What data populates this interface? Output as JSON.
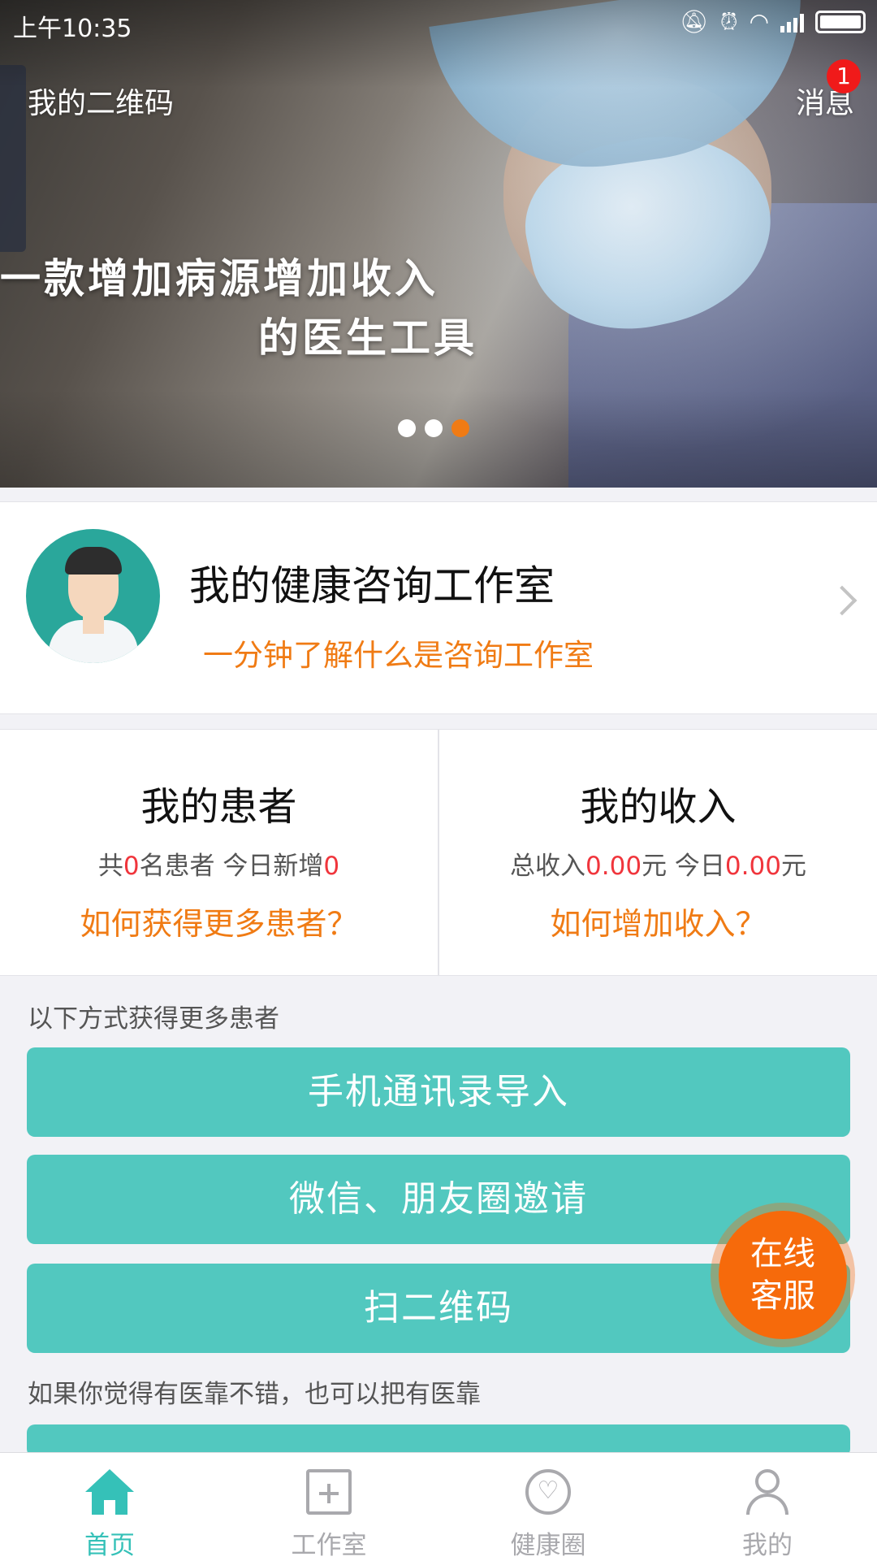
{
  "status_bar": {
    "time": "上午10:35",
    "icons": [
      "mute-icon",
      "alarm-icon",
      "wifi-icon",
      "signal-icon",
      "battery-icon"
    ]
  },
  "banner": {
    "qr_label": "我的二维码",
    "message_label": "消息",
    "message_badge": "1",
    "headline_1": "一款增加病源增加收入",
    "headline_2": "的医生工具",
    "slides_total": 3,
    "slide_active": 3
  },
  "studio": {
    "title": "我的健康咨询工作室",
    "subtitle": "一分钟了解什么是咨询工作室"
  },
  "stats": {
    "patients": {
      "title": "我的患者",
      "prefix": "共",
      "total": "0",
      "mid": "名患者 今日新增",
      "today": "0",
      "link": "如何获得更多患者？"
    },
    "income": {
      "title": "我的收入",
      "prefix": "总收入",
      "total": "0.00",
      "mid": "元 今日",
      "today": "0.00",
      "suffix": "元",
      "link": "如何增加收入？"
    }
  },
  "actions": {
    "label": "以下方式获得更多患者",
    "buttons": [
      "手机通讯录导入",
      "微信、朋友圈邀请",
      "扫二维码"
    ],
    "footer_text": "如果你觉得有医靠不错，也可以把有医靠"
  },
  "float_service": {
    "line1": "在线",
    "line2": "客服"
  },
  "tabs": [
    {
      "label": "首页",
      "icon": "home-icon",
      "active": true
    },
    {
      "label": "工作室",
      "icon": "plus-box-icon",
      "active": false
    },
    {
      "label": "健康圈",
      "icon": "heart-circle-icon",
      "active": false
    },
    {
      "label": "我的",
      "icon": "user-icon",
      "active": false
    }
  ],
  "colors": {
    "accent": "#52c8bf",
    "orange": "#f07b14",
    "red": "#f0353c",
    "tab_active": "#35c1b8"
  }
}
